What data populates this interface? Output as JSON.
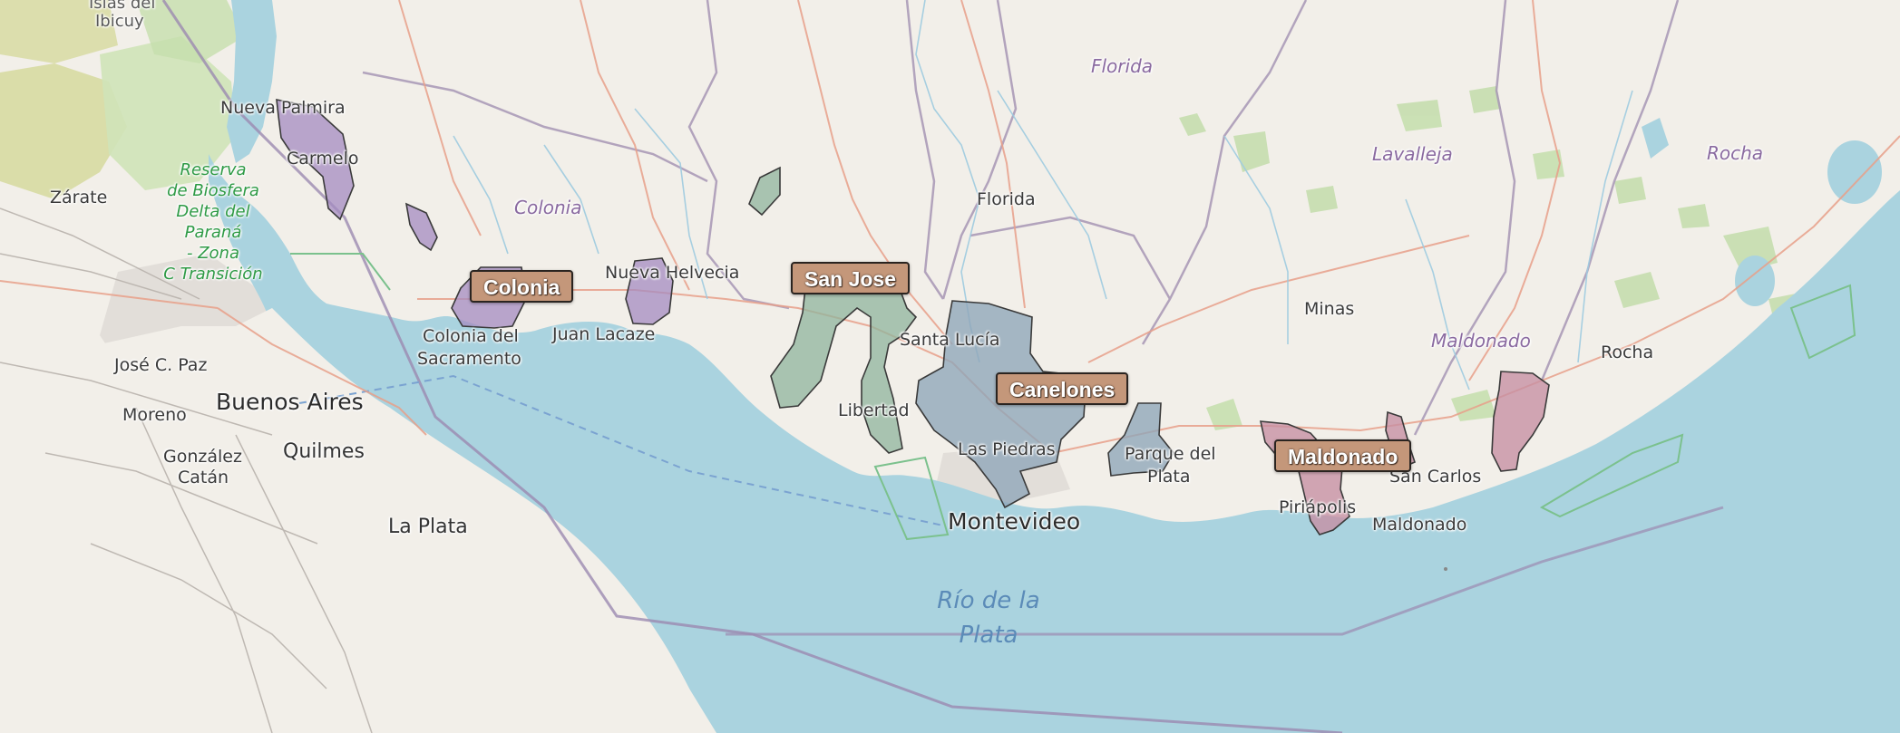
{
  "map": {
    "colors": {
      "land": "#f2efe9",
      "water": "#aad3df",
      "colonia_poly": "#a48bc0",
      "sanjose_poly": "#8fb49c",
      "canelones_poly": "#8ea5b8",
      "maldonado_poly": "#c78ea3",
      "label_bg": "#c4977a",
      "label_border": "#2a2420"
    },
    "department_labels": {
      "colonia": "Colonia",
      "san_jose": "San Jose",
      "canelones": "Canelones",
      "maldonado": "Maldonado"
    },
    "places": {
      "islas_del_ibicuy_1": "Islas del",
      "islas_del_ibicuy_2": "Ibicuy",
      "nueva_palmira": "Nueva Palmira",
      "carmelo": "Carmelo",
      "zarate": "Zárate",
      "reserva_1": "Reserva",
      "reserva_2": "de Biosfera",
      "reserva_3": "Delta del",
      "reserva_4": "Paraná",
      "reserva_5": "- Zona",
      "reserva_6": "C Transición",
      "colonia_region": "Colonia",
      "nueva_helvecia": "Nueva Helvecia",
      "juan_lacaze": "Juan Lacaze",
      "colonia_del_sacramento_1": "Colonia del",
      "colonia_del_sacramento_2": "Sacramento",
      "jose_c_paz": "José C. Paz",
      "buenos_aires": "Buenos Aires",
      "moreno": "Moreno",
      "quilmes": "Quilmes",
      "gonzalez_catan_1": "González",
      "gonzalez_catan_2": "Catán",
      "la_plata": "La Plata",
      "florida_region": "Florida",
      "florida_city": "Florida",
      "santa_lucia": "Santa Lucía",
      "libertad": "Libertad",
      "las_piedras": "Las Piedras",
      "montevideo": "Montevideo",
      "rio_de_la_plata_1": "Río de la",
      "rio_de_la_plata_2": "Plata",
      "parque_del_plata_1": "Parque del",
      "parque_del_plata_2": "Plata",
      "lavalleja": "Lavalleja",
      "minas": "Minas",
      "maldonado_region": "Maldonado",
      "piriapolis": "Piriápolis",
      "maldonado_city": "Maldonado",
      "san_carlos": "San Carlos",
      "rocha_region": "Rocha",
      "rocha_city": "Rocha"
    }
  }
}
